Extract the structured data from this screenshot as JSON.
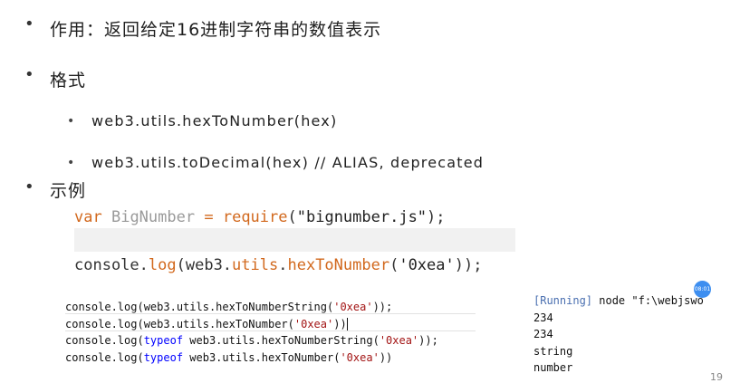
{
  "bullets": {
    "symbol": "•",
    "sub_symbol": "•"
  },
  "heading": {
    "purpose": "作用：返回给定16进制字符串的数值表示",
    "format": "格式",
    "example": "示例"
  },
  "formats": [
    "web3.utils.hexToNumber(hex)",
    "web3.utils.toDecimal(hex) // ALIAS, deprecated"
  ],
  "code": {
    "line1": {
      "kw": "var",
      "name": "BigNumber",
      "eq": "=",
      "fn": "require",
      "open": "(",
      "arg": "\"bignumber.js\"",
      "close": ");"
    },
    "line3": {
      "obj": "console",
      "dot1": ".",
      "method": "log",
      "open": "(web3.",
      "utils": "utils",
      "dot2": ".",
      "fn": "hexToNumber",
      "open2": "(",
      "arg": "'0xea'",
      "close": "));"
    }
  },
  "snippet": [
    {
      "pre": "console.log(web3.utils.hexToNumberString(",
      "kw": "",
      "arg": "'0xea'",
      "post": "));"
    },
    {
      "pre": "console.log(web3.utils.hexToNumber(",
      "kw": "",
      "arg": "'0xea'",
      "post": "))"
    },
    {
      "pre": "console.log(",
      "kw": "typeof",
      "mid": " web3.utils.hexToNumberString(",
      "arg": "'0xea'",
      "post": "));"
    },
    {
      "pre": "console.log(",
      "kw": "typeof",
      "mid": " web3.utils.hexToNumber(",
      "arg": "'0xea'",
      "post": "))"
    }
  ],
  "output": {
    "running": "[Running]",
    "command": " node \"f:\\webjswo",
    "lines": [
      "234",
      "234",
      "string",
      "number"
    ]
  },
  "badge": "08:01",
  "page_number": "19",
  "colors": {
    "code_keyword": "#d2691e",
    "string_literal": "#a31515",
    "typeof_keyword": "#0000ff",
    "running_label": "#4a6fb0",
    "badge": "#3d8ef0"
  }
}
